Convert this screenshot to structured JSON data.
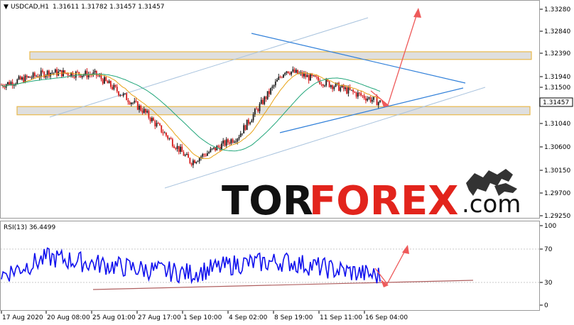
{
  "header": {
    "symbol": "USDCAD,H1",
    "ohlc": "1.31611 1.31782 1.31457 1.31457"
  },
  "price_axis": {
    "labels": [
      "1.33280",
      "1.32840",
      "1.32390",
      "1.31940",
      "1.31500",
      "1.31040",
      "1.30600",
      "1.30150",
      "1.29700",
      "1.29250"
    ],
    "current": "1.31457"
  },
  "rsi": {
    "title": "RSI(13) 36.4499",
    "labels": [
      "100",
      "70",
      "30",
      "0"
    ]
  },
  "time_axis": {
    "labels": [
      "17 Aug 2020",
      "20 Aug 08:00",
      "25 Aug 01:00",
      "27 Aug 17:00",
      "1 Sep 10:00",
      "4 Sep 02:00",
      "8 Sep 19:00",
      "11 Sep 11:00",
      "16 Sep 04:00"
    ]
  },
  "watermark": {
    "part1": "TOR",
    "part2": "FOREX",
    "part3": ".com",
    "logo_icon": "bull-bear-logo-icon"
  },
  "colors": {
    "candle_up": "#1a1a1a",
    "candle_down": "#d61a1a",
    "ma_fast": "#e8a317",
    "ma_slow": "#21a67a",
    "rsi_line": "#1010ee",
    "trend_blue": "#2f7fd9",
    "arrow": "#ee5a5a",
    "zone_fill": "#d9d9d9",
    "zone_border": "#e8b84a"
  },
  "chart_data": {
    "type": "line",
    "symbol": "USDCAD",
    "timeframe": "H1",
    "ylim": [
      1.2925,
      1.3328
    ],
    "x": [
      "17 Aug 2020",
      "20 Aug 08:00",
      "25 Aug 01:00",
      "27 Aug 17:00",
      "1 Sep 10:00",
      "4 Sep 02:00",
      "8 Sep 19:00",
      "11 Sep 11:00",
      "16 Sep 04:00"
    ],
    "price_close": [
      1.318,
      1.3205,
      1.32,
      1.313,
      1.303,
      1.308,
      1.321,
      1.318,
      1.3146
    ],
    "rsi_ylim": [
      0,
      100
    ],
    "rsi": [
      38,
      60,
      52,
      45,
      40,
      52,
      55,
      45,
      36.4499
    ],
    "zones": [
      [
        1.323,
        1.3245
      ],
      [
        1.3122,
        1.3138
      ]
    ]
  }
}
